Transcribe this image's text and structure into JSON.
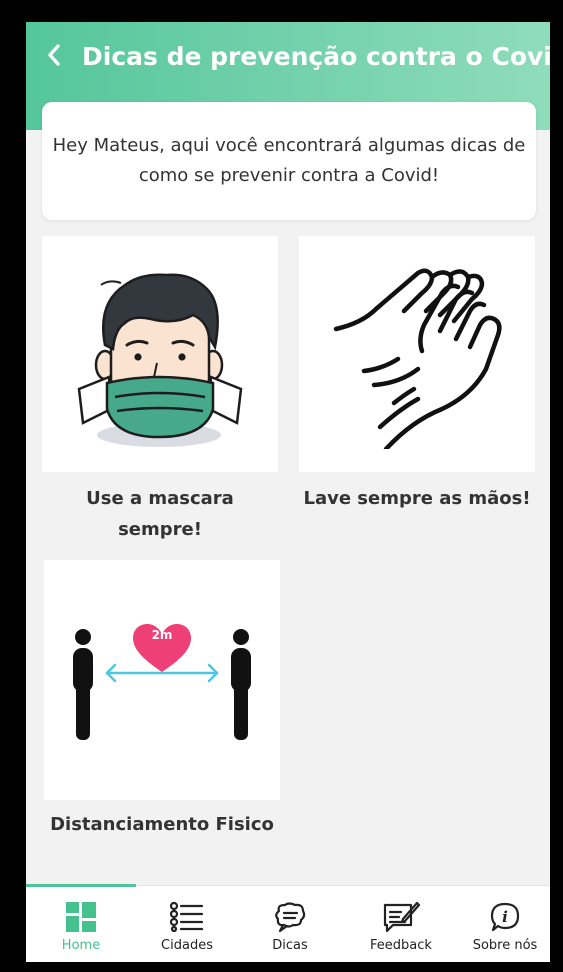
{
  "header": {
    "title": "Dicas de prevenção contra o Covid",
    "back_icon": "chevron-left-icon"
  },
  "intro": {
    "text": "Hey Mateus, aqui você encontrará algumas dicas de como se prevenir contra a Covid!"
  },
  "tips": [
    {
      "label": "Use a mascara sempre!",
      "icon": "masked-face-illustration"
    },
    {
      "label": "Lave sempre as mãos!",
      "icon": "washing-hands-illustration"
    },
    {
      "label": "Distanciamento Fisico",
      "icon": "social-distancing-illustration",
      "badge": "2m"
    }
  ],
  "tabbar": {
    "active": "home",
    "tabs": [
      {
        "id": "home",
        "label": "Home",
        "icon": "home-grid-icon"
      },
      {
        "id": "cidades",
        "label": "Cidades",
        "icon": "list-icon"
      },
      {
        "id": "dicas",
        "label": "Dicas",
        "icon": "chat-bubble-icon"
      },
      {
        "id": "feedback",
        "label": "Feedback",
        "icon": "feedback-edit-icon"
      },
      {
        "id": "sobre",
        "label": "Sobre nós",
        "icon": "info-icon"
      }
    ]
  },
  "colors": {
    "header_start": "#55c69b",
    "header_end": "#8fdcbc",
    "accent": "#44c18e",
    "mask": "#46a98a",
    "heart": "#ef3f78",
    "arrow": "#4cc6e3"
  }
}
